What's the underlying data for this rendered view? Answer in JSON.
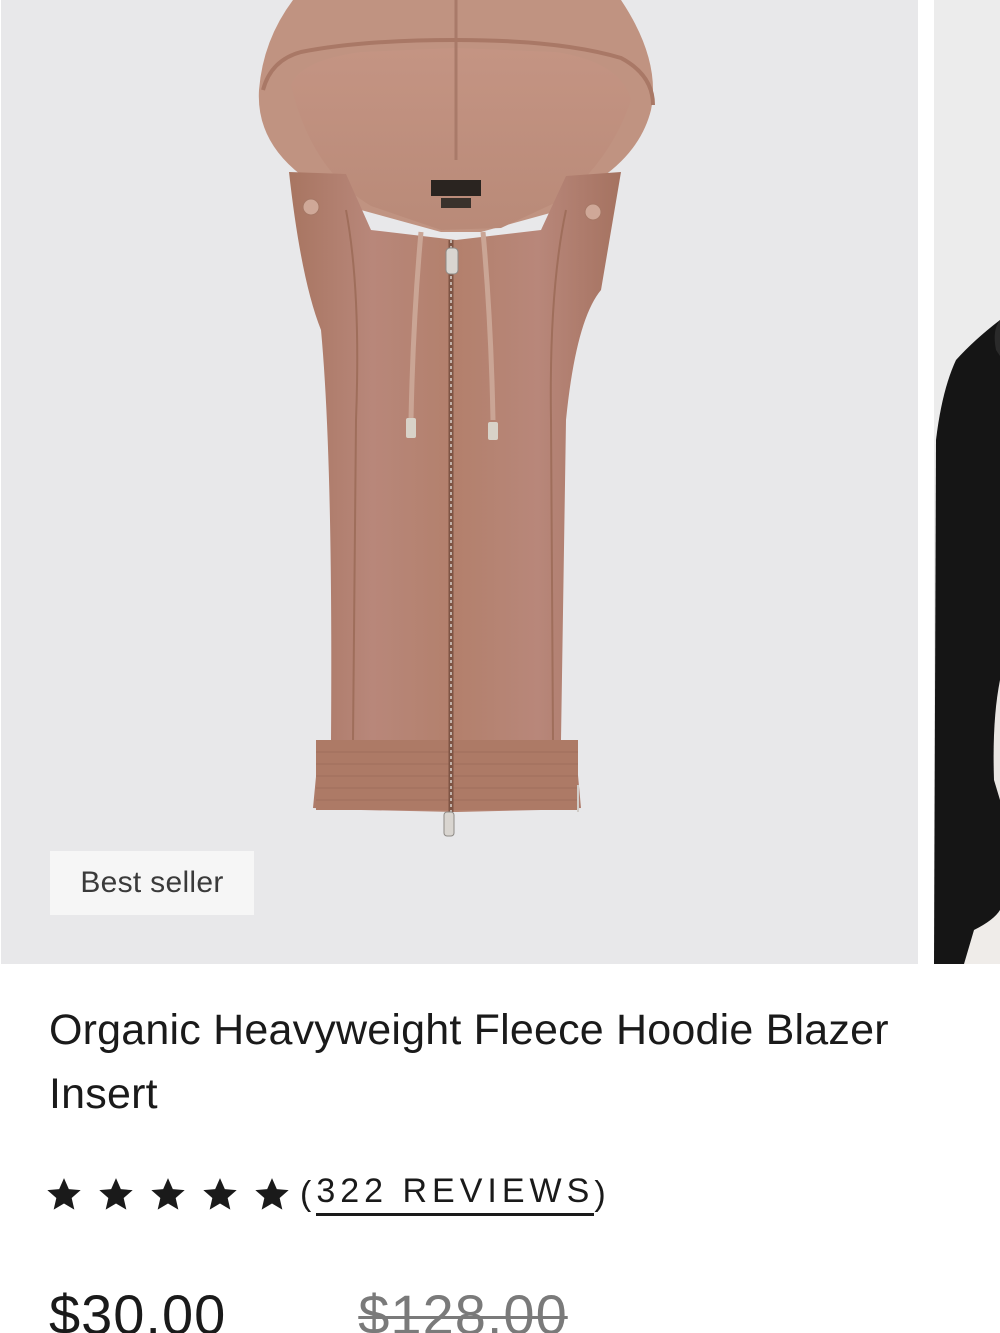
{
  "gallery": {
    "badge": "Best seller",
    "main_image": "hoodie-blazer-insert-product-photo",
    "peek_image": "model-wearing-insert-photo",
    "product_color": "#b07e6a",
    "background_color": "#e8e8ea"
  },
  "product": {
    "title": "Organic Heavyweight Fleece Hoodie Blazer Insert",
    "rating": {
      "stars": 5,
      "max_stars": 5,
      "open_paren": "(",
      "reviews_label": "322 REVIEWS",
      "close_paren": ")"
    },
    "price": {
      "current": "$30.00",
      "original": "$128.00"
    }
  },
  "colors": {
    "text": "#1a1a1a",
    "muted": "#7a7a7a",
    "badge_bg": "#f6f6f6"
  },
  "icons": [
    "star-icon"
  ]
}
